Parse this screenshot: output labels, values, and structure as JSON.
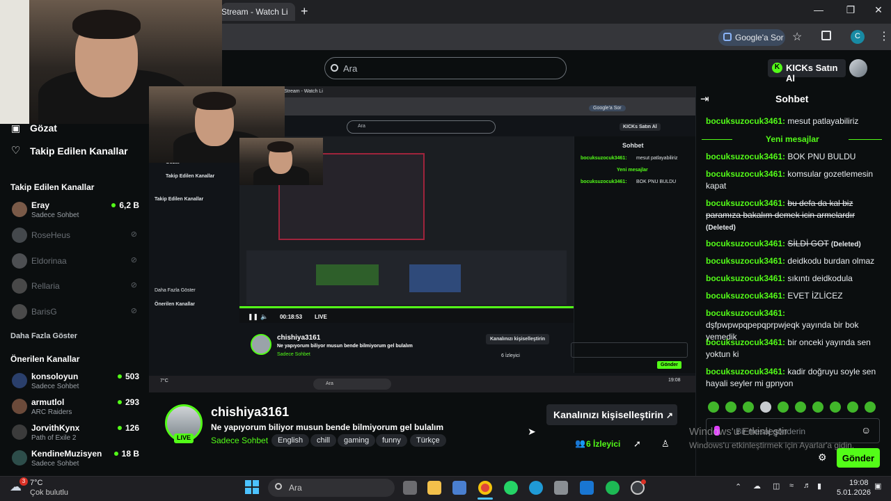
{
  "browser": {
    "tab_title": "Stream - Watch Li",
    "new_tab": "+",
    "ask_google": "Google'a Sor",
    "profile_initial": "C"
  },
  "header": {
    "search_placeholder": "Ara",
    "kicks_button": "KICKs Satın Al"
  },
  "sidebar": {
    "nav": [
      {
        "label": "Gözat"
      },
      {
        "label": "Takip Edilen Kanallar"
      }
    ],
    "followed_title": "Takip Edilen Kanallar",
    "followed": [
      {
        "name": "Eray",
        "category": "Sadece Sohbet",
        "viewers": "6,2 B"
      },
      {
        "name": "RoseHeus"
      },
      {
        "name": "Eldorinaa"
      },
      {
        "name": "Rellaria"
      },
      {
        "name": "BarisG"
      }
    ],
    "show_more": "Daha Fazla Göster",
    "recommended_title": "Önerilen Kanallar",
    "recommended": [
      {
        "name": "konsoloyun",
        "category": "Sadece Sohbet",
        "viewers": "503"
      },
      {
        "name": "armutlol",
        "category": "ARC Raiders",
        "viewers": "293"
      },
      {
        "name": "JorvithKynx",
        "category": "Path of Exile 2",
        "viewers": "126"
      },
      {
        "name": "KendineMuzisyen",
        "category": "Sadece Sohbet",
        "viewers": "18 B"
      }
    ]
  },
  "player": {
    "time": "00:18:53",
    "live": "LIVE"
  },
  "stream": {
    "channel": "chishiya3161",
    "title": "Ne yapıyorum biliyor musun bende bilmiyorum gel bulalım",
    "category": "Sadece Sohbet",
    "tags": [
      "English",
      "chill",
      "gaming",
      "funny",
      "Türkçe"
    ],
    "live_badge": "LIVE",
    "customize_button": "Kanalınızı kişiselleştirin",
    "viewers": "6",
    "viewers_label": "İzleyici"
  },
  "chat": {
    "title": "Sohbet",
    "new_messages": "Yeni mesajlar",
    "messages": [
      {
        "user": "bocuksuzocuk3461:",
        "text": "mesut patlayabiliriz"
      },
      {
        "user": "bocuksuzocuk3461:",
        "text": "BOK PNU BULDU"
      },
      {
        "user": "bocuksuzocuk3461:",
        "text": "komsular gozetlemesin kapat"
      },
      {
        "user": "bocuksuzocuk3461:",
        "text": "bu defa da kal biz paramıza bakalım demek icin armelardır",
        "deleted": "(Deleted)"
      },
      {
        "user": "bocuksuzocuk3461:",
        "text": "SİLDİ GOT",
        "deleted": "(Deleted)"
      },
      {
        "user": "bocuksuzocuk3461:",
        "text": "deidkodu burdan olmaz"
      },
      {
        "user": "bocuksuzocuk3461:",
        "text": "sıkıntı deidkodula"
      },
      {
        "user": "bocuksuzocuk3461:",
        "text": "EVET İZLİCEZ"
      },
      {
        "user": "bocuksuzocuk3461:",
        "text": "dşfpwpwpqpepqprpwjeqk yayında bir bok yemedik"
      },
      {
        "user": "bocuksuzocuk3461:",
        "text": "bir onceki yayında sen yoktun ki"
      },
      {
        "user": "bocuksuzocuk3461:",
        "text": "kadir doğruyu soyle sen hayali seyler mi gpnyon"
      }
    ],
    "input_placeholder": "Bir mesaj gönderin",
    "send": "Gönder",
    "watermark_title": "Windows'u Etkinleştir",
    "watermark_sub": "Windows'u etkinleştirmek için Ayarlar'a gidin."
  },
  "taskbar": {
    "weather_temp": "7°C",
    "weather_desc": "Çok bulutlu",
    "weather_badge": "3",
    "search": "Ara",
    "time": "19:08",
    "date": "5.01.2026"
  },
  "colors": {
    "accent": "#53fc18",
    "background": "#0b0e0f",
    "chrome": "#35363a"
  }
}
